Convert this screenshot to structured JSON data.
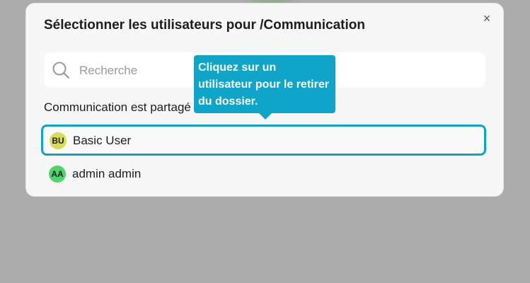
{
  "dialog": {
    "title": "Sélectionner les utilisateurs pour /Communication",
    "close_label": "×"
  },
  "search": {
    "placeholder": "Recherche",
    "value": "",
    "icon": "search-icon"
  },
  "shared_label": "Communication est partagé avec",
  "users": [
    {
      "initials": "BU",
      "name": "Basic User",
      "avatar_color": "#d9dd55",
      "highlighted": true
    },
    {
      "initials": "AA",
      "name": "admin admin",
      "avatar_color": "#4fd46a",
      "highlighted": false
    }
  ],
  "tooltip": {
    "text": "Cliquez sur un utilisateur pour le retirer du dossier."
  },
  "colors": {
    "accent": "#11a3c7",
    "tooltip_bg": "#0ea5c9",
    "backdrop": "#acacac"
  }
}
